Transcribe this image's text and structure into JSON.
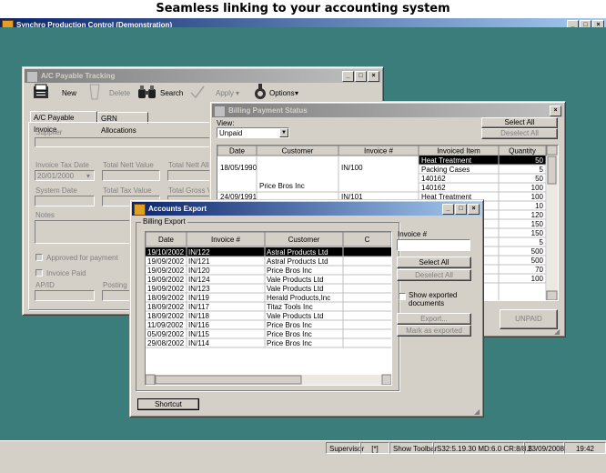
{
  "caption": "Seamless linking to your accounting system",
  "app": {
    "title": "Synchro Production Control (Demonstration)",
    "menus": [
      "Sales File",
      "Bought File",
      "Reports",
      "Chem & Phys",
      "Messaging",
      "Setup",
      "Security",
      "Window",
      "Help"
    ],
    "status": {
      "user": "Supervisor",
      "flag": "[*]",
      "toolbar": "Show Toolbar",
      "version": "S32:5.19.30 MD:6.0 CR:8/8.5",
      "date": "23/09/2008",
      "time": "19:42"
    }
  },
  "ap": {
    "title": "A/C Payable Tracking",
    "toolbar": {
      "new": "New",
      "delete": "Delete",
      "search": "Search",
      "apply": "Apply",
      "options": "Options"
    },
    "tabs": [
      "A/C Payable Invoice",
      "GRN Allocations"
    ],
    "labels": {
      "supplier": "Supplier",
      "invoice_tax_date": "Invoice Tax Date",
      "total_nett": "Total Nett Value",
      "total_nett_alloc": "Total Nett Allo",
      "system_date": "System Date",
      "total_tax": "Total Tax Value",
      "total_gross": "Total Gross Va",
      "notes": "Notes",
      "approved": "Approved for payment",
      "invoice_paid": "Invoice Paid",
      "apid": "AP/ID",
      "posting": "Posting No"
    },
    "invoice_tax_date_value": "20/01/2000"
  },
  "billing": {
    "title": "Billing Payment Status",
    "view_label": "View:",
    "view_value": "Unpaid",
    "select_all": "Select All",
    "deselect_all": "Deselect All",
    "unpaid_button": "UNPAID",
    "columns": [
      "Date",
      "Customer",
      "Invoice #",
      "Invoiced Item",
      "Quantity",
      "C"
    ],
    "rows": [
      {
        "date": "18/05/1990",
        "customer": "Price Bros Inc",
        "invoice": "IN/100",
        "item": "Heat Treatment",
        "qty": "50"
      },
      {
        "date": "",
        "customer": "",
        "invoice": "",
        "item": "Packing Cases",
        "qty": "5"
      },
      {
        "date": "",
        "customer": "",
        "invoice": "",
        "item": "140162",
        "qty": "50"
      },
      {
        "date": "",
        "customer": "",
        "invoice": "",
        "item": "140162",
        "qty": "100"
      },
      {
        "date": "24/09/1991",
        "customer": "",
        "invoice": "IN/101",
        "item": "Heat Treatment",
        "qty": "100"
      },
      {
        "date": "",
        "customer": "",
        "invoice": "",
        "item": "",
        "qty": "10"
      },
      {
        "date": "",
        "customer": "",
        "invoice": "",
        "item": "",
        "qty": "120"
      },
      {
        "date": "",
        "customer": "",
        "invoice": "",
        "item": "",
        "qty": "150"
      },
      {
        "date": "",
        "customer": "",
        "invoice": "",
        "item": "",
        "qty": "150"
      },
      {
        "date": "",
        "customer": "",
        "invoice": "",
        "item": "",
        "qty": "5"
      },
      {
        "date": "",
        "customer": "",
        "invoice": "",
        "item": "",
        "qty": "500"
      },
      {
        "date": "",
        "customer": "",
        "invoice": "",
        "item": "",
        "qty": "500"
      },
      {
        "date": "",
        "customer": "",
        "invoice": "",
        "item": "",
        "qty": "70"
      },
      {
        "date": "",
        "customer": "",
        "invoice": "",
        "item": "",
        "qty": "100"
      }
    ]
  },
  "export": {
    "title": "Accounts Export",
    "group": "Billing Export",
    "columns": [
      "Date",
      "Invoice #",
      "Customer",
      "C"
    ],
    "rows": [
      {
        "date": "19/10/2002",
        "invoice": "IN/122",
        "customer": "Astral Products Ltd"
      },
      {
        "date": "19/09/2002",
        "invoice": "IN/121",
        "customer": "Astral Products Ltd"
      },
      {
        "date": "19/09/2002",
        "invoice": "IN/120",
        "customer": "Price Bros Inc"
      },
      {
        "date": "19/09/2002",
        "invoice": "IN/124",
        "customer": "Vale Products Ltd"
      },
      {
        "date": "19/09/2002",
        "invoice": "IN/123",
        "customer": "Vale Products Ltd"
      },
      {
        "date": "18/09/2002",
        "invoice": "IN/119",
        "customer": "Herald Products,Inc"
      },
      {
        "date": "18/09/2002",
        "invoice": "IN/117",
        "customer": "Titaz Tools Inc"
      },
      {
        "date": "18/09/2002",
        "invoice": "IN/118",
        "customer": "Vale Products Ltd"
      },
      {
        "date": "11/09/2002",
        "invoice": "IN/116",
        "customer": "Price Bros Inc"
      },
      {
        "date": "05/09/2002",
        "invoice": "IN/115",
        "customer": "Price Bros Inc"
      },
      {
        "date": "29/08/2002",
        "invoice": "IN/114",
        "customer": "Price Bros Inc"
      }
    ],
    "invoice_label": "Invoice #",
    "select_all": "Select All",
    "deselect_all": "Deselect All",
    "show_exported": "Show exported documents",
    "export_button": "Export...",
    "mark_button": "Mark as exported",
    "shortcut": "Shortcut"
  }
}
